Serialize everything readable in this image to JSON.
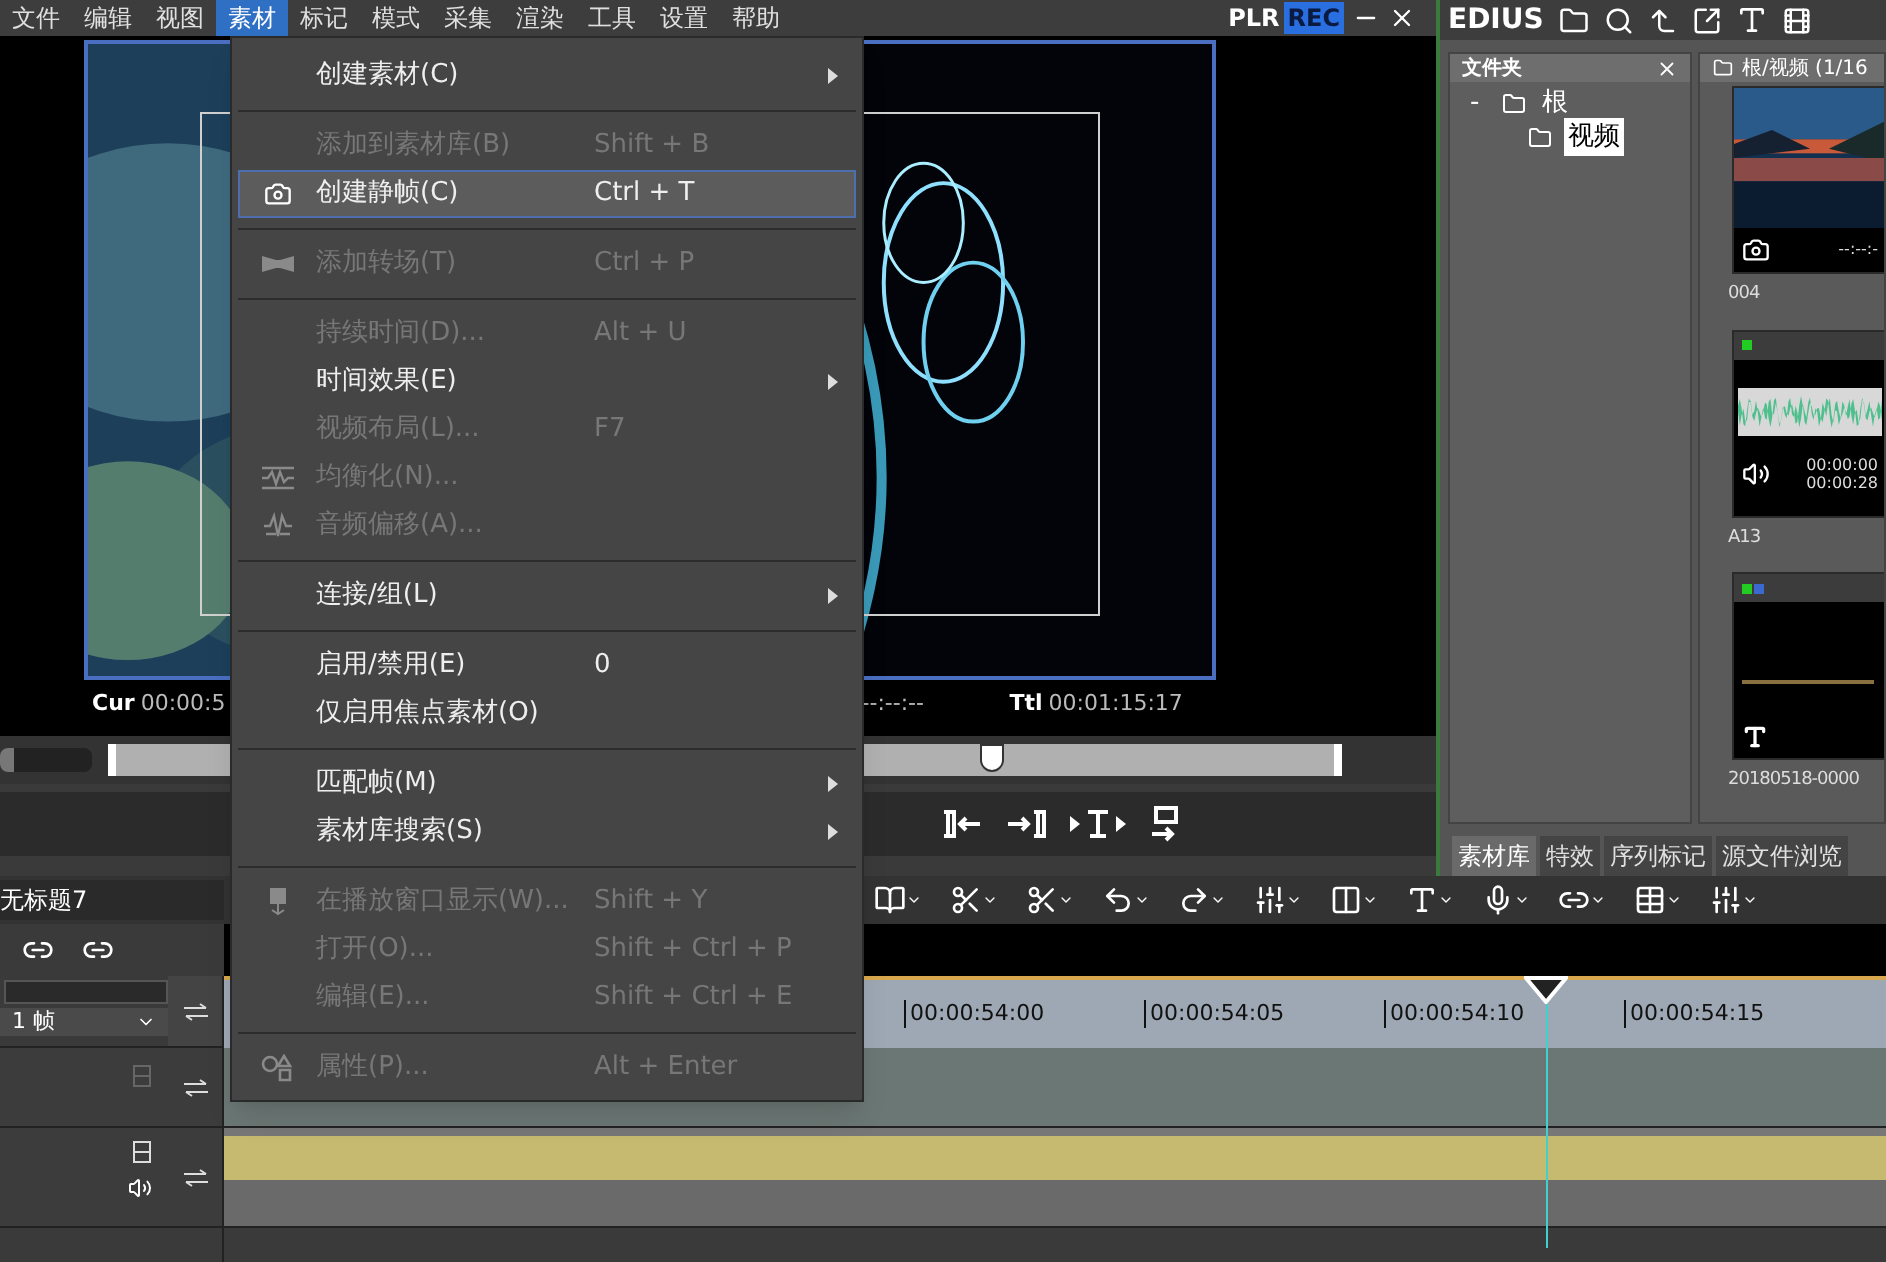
{
  "menubar": [
    {
      "label": "文件",
      "selected": false
    },
    {
      "label": "编辑",
      "selected": false
    },
    {
      "label": "视图",
      "selected": false
    },
    {
      "label": "素材",
      "selected": true
    },
    {
      "label": "标记",
      "selected": false
    },
    {
      "label": "模式",
      "selected": false
    },
    {
      "label": "采集",
      "selected": false
    },
    {
      "label": "渲染",
      "selected": false
    },
    {
      "label": "工具",
      "selected": false
    },
    {
      "label": "设置",
      "selected": false
    },
    {
      "label": "帮助",
      "selected": false
    }
  ],
  "player": {
    "modes": [
      {
        "label": "PLR",
        "selected": false
      },
      {
        "label": "REC",
        "selected": true
      }
    ],
    "cur_label": "Cur",
    "cur_time": "00:00:5",
    "in_out": "--:--:--",
    "ttl_label": "Ttl",
    "ttl_time": "00:01:15:17",
    "scrub": {
      "level": 0.72
    },
    "volume": {
      "level": 0.15
    }
  },
  "menu": {
    "items": [
      {
        "kind": "item",
        "label": "创建素材(C)",
        "submenu": true,
        "disabled": false,
        "selected": false
      },
      {
        "kind": "separator"
      },
      {
        "kind": "item",
        "label": "添加到素材库(B)",
        "shortcut": "Shift + B",
        "submenu": false,
        "disabled": true,
        "selected": false
      },
      {
        "kind": "item",
        "label": "创建静帧(C)",
        "shortcut": "Ctrl + T",
        "submenu": false,
        "disabled": false,
        "selected": true
      },
      {
        "kind": "separator"
      },
      {
        "kind": "item",
        "label": "添加转场(T)",
        "shortcut": "Ctrl + P",
        "submenu": false,
        "disabled": true,
        "selected": false
      },
      {
        "kind": "separator"
      },
      {
        "kind": "item",
        "label": "持续时间(D)...",
        "shortcut": "Alt + U",
        "submenu": false,
        "disabled": true,
        "selected": false
      },
      {
        "kind": "item",
        "label": "时间效果(E)",
        "submenu": true,
        "disabled": false,
        "selected": false
      },
      {
        "kind": "item",
        "label": "视频布局(L)...",
        "shortcut": "F7",
        "submenu": false,
        "disabled": true,
        "selected": false
      },
      {
        "kind": "item",
        "label": "均衡化(N)...",
        "submenu": false,
        "disabled": true,
        "selected": false
      },
      {
        "kind": "item",
        "label": "音频偏移(A)...",
        "submenu": false,
        "disabled": true,
        "selected": false
      },
      {
        "kind": "separator"
      },
      {
        "kind": "item",
        "label": "连接/组(L)",
        "submenu": true,
        "disabled": false,
        "selected": false
      },
      {
        "kind": "separator"
      },
      {
        "kind": "item",
        "label": "启用/禁用(E)",
        "shortcut": "0",
        "submenu": false,
        "disabled": false,
        "selected": false
      },
      {
        "kind": "item",
        "label": "仅启用焦点素材(O)",
        "submenu": false,
        "disabled": false,
        "selected": false
      },
      {
        "kind": "separator"
      },
      {
        "kind": "item",
        "label": "匹配帧(M)",
        "submenu": true,
        "disabled": false,
        "selected": false
      },
      {
        "kind": "item",
        "label": "素材库搜索(S)",
        "submenu": true,
        "disabled": false,
        "selected": false
      },
      {
        "kind": "separator"
      },
      {
        "kind": "item",
        "label": "在播放窗口显示(W)...",
        "shortcut": "Shift + Y",
        "submenu": false,
        "disabled": true,
        "selected": false
      },
      {
        "kind": "item",
        "label": "打开(O)...",
        "shortcut": "Shift + Ctrl + P",
        "submenu": false,
        "disabled": true,
        "selected": false
      },
      {
        "kind": "item",
        "label": "编辑(E)...",
        "shortcut": "Shift + Ctrl + E",
        "submenu": false,
        "disabled": true,
        "selected": false
      },
      {
        "kind": "separator"
      },
      {
        "kind": "item",
        "label": "属性(P)...",
        "shortcut": "Alt + Enter",
        "submenu": false,
        "disabled": true,
        "selected": false
      }
    ]
  },
  "library": {
    "app_name": "EDIUS",
    "folders": {
      "title": "文件夹",
      "tree": [
        {
          "toggle": "-",
          "label": "根",
          "selected": false,
          "children": [
            {
              "label": "视频",
              "selected": true
            }
          ]
        }
      ]
    },
    "bin": {
      "path": "根/视频 (1/16",
      "clips": [
        {
          "kind": "video",
          "name": "004",
          "timecodes": [
            "--:--:-"
          ]
        },
        {
          "kind": "audio",
          "name": "A13",
          "timecodes": [
            "00:00:00",
            "00:00:28"
          ]
        },
        {
          "kind": "title",
          "name": "20180518-0000"
        }
      ]
    },
    "tabs": [
      {
        "label": "素材库",
        "selected": true
      },
      {
        "label": "特效",
        "selected": false
      },
      {
        "label": "序列标记",
        "selected": false
      },
      {
        "label": "源文件浏览",
        "selected": false
      }
    ]
  },
  "timeline": {
    "sequence": "无标题7",
    "frame_step": "1 帧",
    "ruler": [
      "00:00:54:00",
      "00:00:54:05",
      "00:00:54:10",
      "00:00:54:15"
    ]
  }
}
